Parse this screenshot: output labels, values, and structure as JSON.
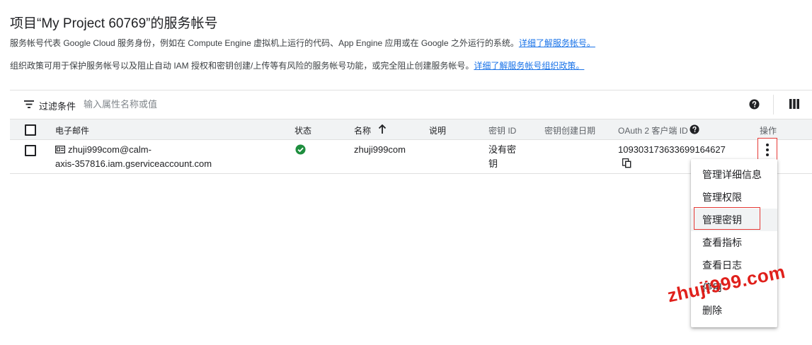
{
  "page": {
    "title": "项目“My Project 60769”的服务帐号",
    "description1": "服务帐号代表 Google Cloud 服务身份，例如在 Compute Engine 虚拟机上运行的代码、App Engine 应用或在 Google 之外运行的系统。",
    "description1_link": "详细了解服务帐号。",
    "description2": "组织政策可用于保护服务帐号以及阻止自动 IAM 授权和密钥创建/上传等有风险的服务帐号功能，或完全阻止创建服务帐号。",
    "description2_link": "详细了解服务帐号组织政策。"
  },
  "filter": {
    "label": "过滤条件",
    "placeholder": "输入属性名称或值"
  },
  "table": {
    "headers": {
      "email": "电子邮件",
      "status": "状态",
      "name": "名称",
      "description": "说明",
      "key_id": "密钥 ID",
      "key_created": "密钥创建日期",
      "oauth_client_id": "OAuth 2 客户端 ID",
      "actions": "操作"
    },
    "rows": [
      {
        "email_line1": "zhuji999com@calm-",
        "email_line2": "axis-357816.iam.gserviceaccount.com",
        "status": "enabled",
        "name": "zhuji999com",
        "description": "",
        "key_id": "没有密钥",
        "key_created": "",
        "oauth_client_id": "109303173633699164627"
      }
    ]
  },
  "menu": {
    "items": [
      "管理详细信息",
      "管理权限",
      "管理密钥",
      "查看指标",
      "查看日志",
      "停用",
      "删除"
    ],
    "highlighted_index": 2
  },
  "watermark": {
    "text": "zhuji999.com"
  },
  "colors": {
    "link": "#1a73e8",
    "status_ok": "#1e8e3e",
    "highlight_border": "#e53935",
    "watermark": "#e0201b"
  }
}
